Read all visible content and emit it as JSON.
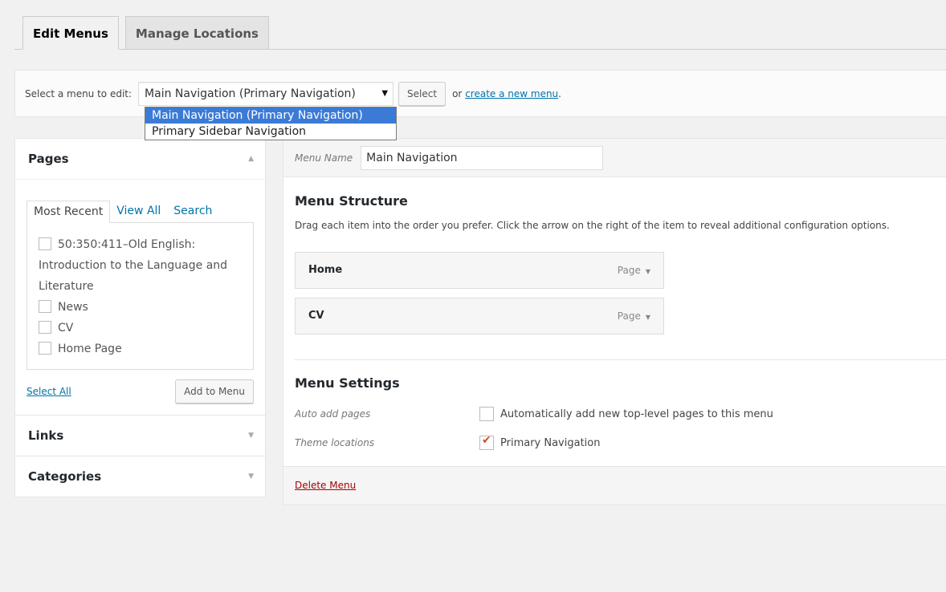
{
  "tabs": [
    {
      "label": "Edit Menus",
      "active": true
    },
    {
      "label": "Manage Locations",
      "active": false
    }
  ],
  "manage": {
    "label": "Select a menu to edit:",
    "selected": "Main Navigation (Primary Navigation)",
    "select_button": "Select",
    "or_text": "or",
    "create_link": "create a new menu",
    "trailing": "."
  },
  "dropdown": {
    "options": [
      "Main Navigation (Primary Navigation)",
      "Primary Sidebar Navigation"
    ]
  },
  "sidebar": {
    "pages_title": "Pages",
    "subtabs": [
      "Most Recent",
      "View All",
      "Search"
    ],
    "pages": [
      "50:350:411–Old English: Introduction to the Language and Literature",
      "News",
      "CV",
      "Home Page"
    ],
    "select_all": "Select All",
    "add_button": "Add to Menu",
    "links_title": "Links",
    "categories_title": "Categories"
  },
  "menu": {
    "name_label": "Menu Name",
    "name_value": "Main Navigation",
    "structure_title": "Menu Structure",
    "instructions": "Drag each item into the order you prefer. Click the arrow on the right of the item to reveal additional configuration options.",
    "items": [
      {
        "title": "Home",
        "type": "Page"
      },
      {
        "title": "CV",
        "type": "Page"
      }
    ],
    "settings_title": "Menu Settings",
    "auto_add_label": "Auto add pages",
    "auto_add_text": "Automatically add new top-level pages to this menu",
    "auto_add_checked": false,
    "theme_label": "Theme locations",
    "theme_text": "Primary Navigation",
    "theme_checked": true,
    "delete_link": "Delete Menu"
  },
  "colors": {
    "link": "#0073aa",
    "delete": "#aa0000",
    "highlight": "#3b7bd6",
    "checkmark": "#d54e21"
  },
  "icons": {
    "dropdown_caret": "caret-down-icon",
    "accordion_open": "triangle-up-icon",
    "accordion_closed": "triangle-down-icon",
    "item_expand": "triangle-down-icon",
    "checkmark": "checkmark-icon"
  }
}
